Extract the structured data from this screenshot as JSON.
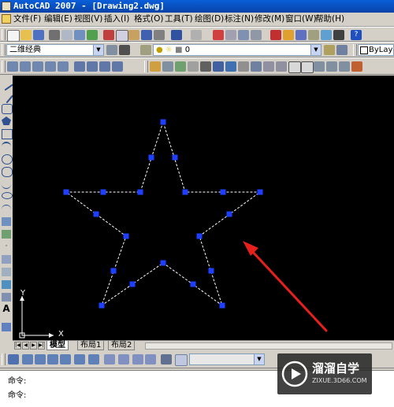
{
  "window": {
    "title": "AutoCAD 2007 - [Drawing2.dwg]"
  },
  "menubar": {
    "items": [
      "文件(F)",
      "编辑(E)",
      "视图(V)",
      "插入(I)",
      "格式(O)",
      "工具(T)",
      "绘图(D)",
      "标注(N)",
      "修改(M)",
      "窗口(W)",
      "帮助(H)"
    ]
  },
  "toolbar_row3": {
    "workspace": "二维经典",
    "layer": "0",
    "linetype": "ByLayer"
  },
  "canvas": {
    "background": "#000000",
    "grip_color": "#1f3fff",
    "arrow_color": "#e8201c",
    "ucs": {
      "y_label": "Y",
      "x_label": "X"
    }
  },
  "layout_tabs": [
    "模型",
    "布局1",
    "布局2"
  ],
  "command_lines": [
    "命令:",
    "命令:"
  ],
  "watermark": {
    "brand": "溜溜自学",
    "url": "ZIXUE.3D66.COM"
  }
}
